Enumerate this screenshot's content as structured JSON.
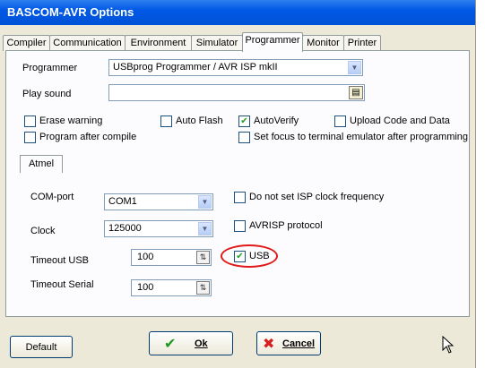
{
  "window": {
    "title": "BASCOM-AVR Options"
  },
  "tabs": [
    "Compiler",
    "Communication",
    "Environment",
    "Simulator",
    "Programmer",
    "Monitor",
    "Printer"
  ],
  "active_tab": "Programmer",
  "programmer": {
    "programmer_label": "Programmer",
    "programmer_value": "USBprog Programmer / AVR ISP mkII",
    "play_sound_label": "Play sound",
    "play_sound_value": "",
    "checkboxes": {
      "erase_warning": {
        "label": "Erase warning",
        "checked": false
      },
      "auto_flash": {
        "label": "Auto Flash",
        "checked": false
      },
      "auto_verify": {
        "label": "AutoVerify",
        "checked": true
      },
      "upload_code": {
        "label": "Upload Code and Data",
        "checked": false
      },
      "program_after": {
        "label": "Program after compile",
        "checked": false
      },
      "set_focus": {
        "label": "Set focus to terminal emulator after programming",
        "checked": false
      }
    }
  },
  "atmel": {
    "tab_label": "Atmel",
    "com_port_label": "COM-port",
    "com_port_value": "COM1",
    "clock_label": "Clock",
    "clock_value": "125000",
    "timeout_usb_label": "Timeout USB",
    "timeout_usb_value": "100",
    "timeout_serial_label": "Timeout Serial",
    "timeout_serial_value": "100",
    "no_isp_clock": {
      "label": "Do not set ISP clock frequency",
      "checked": false
    },
    "avrisp": {
      "label": "AVRISP protocol",
      "checked": false
    },
    "usb": {
      "label": "USB",
      "checked": true
    }
  },
  "buttons": {
    "default": "Default",
    "ok": "Ok",
    "cancel": "Cancel"
  },
  "colors": {
    "highlight_circle": "#e01919",
    "titlebar": "#0058e6",
    "check_mark": "#21a121"
  }
}
